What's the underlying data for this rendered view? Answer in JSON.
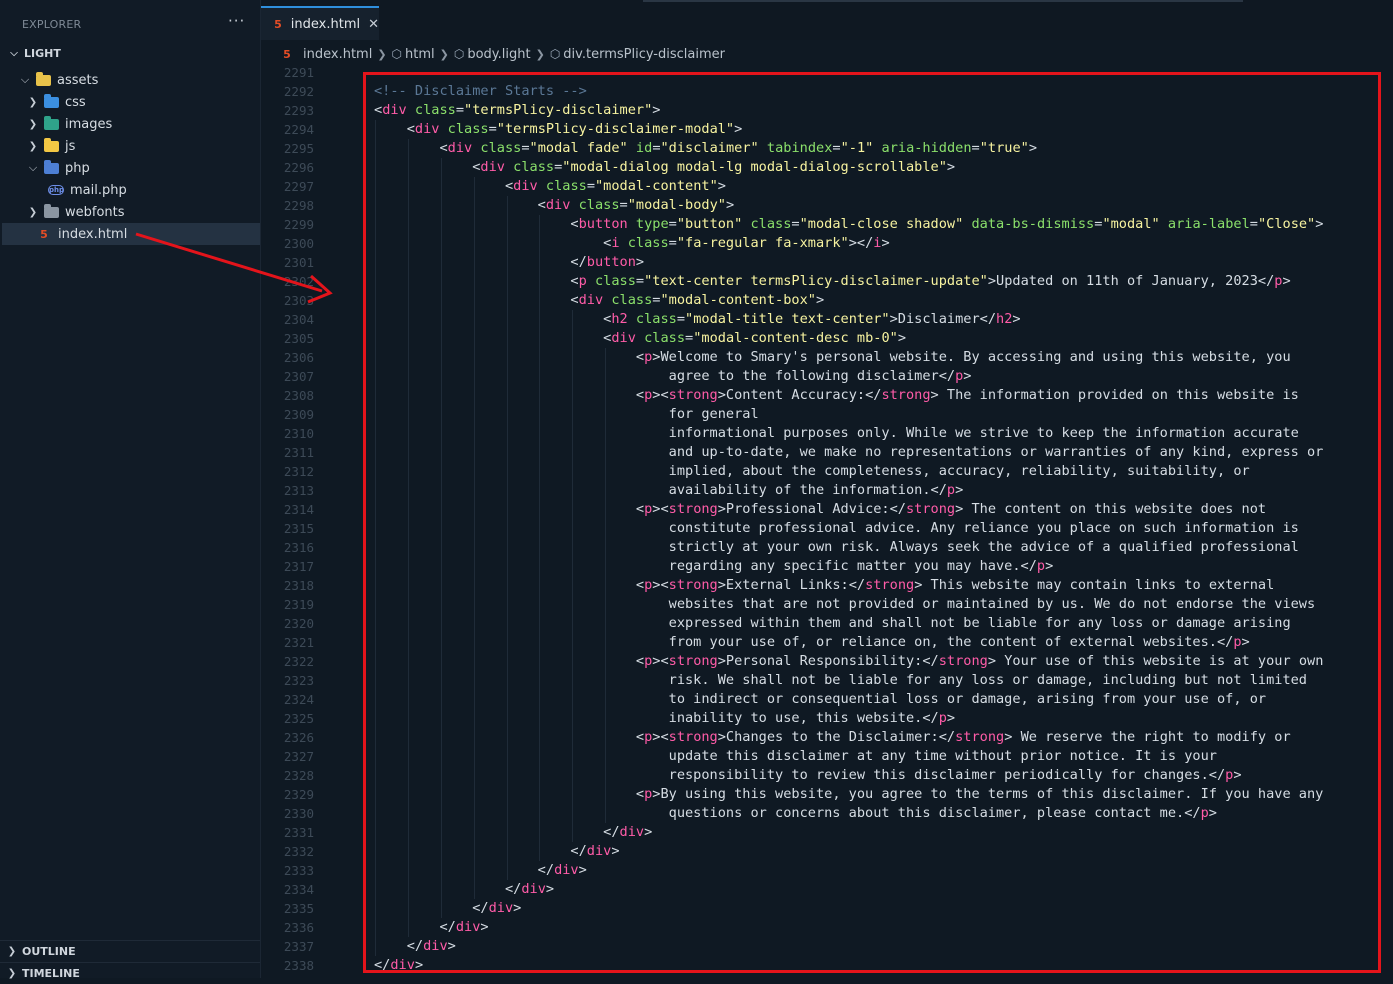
{
  "sidebar": {
    "title": "EXPLORER",
    "more": "···",
    "root": "LIGHT",
    "items": [
      {
        "label": "assets",
        "kind": "folder",
        "color": "#e8c24a",
        "open": true,
        "depth": 1
      },
      {
        "label": "css",
        "kind": "folder",
        "color": "#3b8fe0",
        "open": false,
        "depth": 2
      },
      {
        "label": "images",
        "kind": "folder",
        "color": "#2fa38a",
        "open": false,
        "depth": 2
      },
      {
        "label": "js",
        "kind": "folder",
        "color": "#f2c744",
        "open": false,
        "depth": 2
      },
      {
        "label": "php",
        "kind": "folder",
        "color": "#4d7fd4",
        "open": true,
        "depth": 2
      },
      {
        "label": "mail.php",
        "kind": "php",
        "color": "#6d8ee8",
        "depth": 3
      },
      {
        "label": "webfonts",
        "kind": "folder",
        "color": "#8b96a2",
        "open": false,
        "depth": 2
      },
      {
        "label": "index.html",
        "kind": "html",
        "color": "#e44d26",
        "depth": 1,
        "selected": true
      }
    ],
    "outline": "OUTLINE",
    "timeline": "TIMELINE"
  },
  "tab": {
    "label": "index.html",
    "close": "✕",
    "icon": "html5-icon"
  },
  "breadcrumb": [
    "index.html",
    "html",
    "body.light",
    "div.termsPlicy-disclaimer"
  ],
  "editor": {
    "first_line": 2291,
    "line_numbers": [
      2291,
      2292,
      2293,
      2294,
      2295,
      2296,
      2297,
      2298,
      2299,
      2300,
      2301,
      2302,
      2303,
      2304,
      2305,
      2306,
      2307,
      2308,
      2309,
      2310,
      2311,
      2312,
      2313,
      2314,
      2315,
      2316,
      2317,
      2318,
      2319,
      2320,
      2321,
      2322,
      2323,
      2324,
      2325,
      2326,
      2327,
      2328,
      2329,
      2330,
      2331,
      2332,
      2333,
      2334,
      2335,
      2336,
      2337,
      2338
    ],
    "lines": [
      [],
      [
        [
          "cm",
          "<!-- Disclaimer Starts -->"
        ]
      ],
      [
        [
          "pl",
          "<"
        ],
        [
          "tg",
          "div"
        ],
        [
          "at",
          " class"
        ],
        [
          "pl",
          "="
        ],
        [
          "st",
          "\"termsPlicy-disclaimer\""
        ],
        [
          "pl",
          ">"
        ]
      ],
      [
        [
          "pl",
          "    <"
        ],
        [
          "tg",
          "div"
        ],
        [
          "at",
          " class"
        ],
        [
          "pl",
          "="
        ],
        [
          "st",
          "\"termsPlicy-disclaimer-modal\""
        ],
        [
          "pl",
          ">"
        ]
      ],
      [
        [
          "pl",
          "        <"
        ],
        [
          "tg",
          "div"
        ],
        [
          "at",
          " class"
        ],
        [
          "pl",
          "="
        ],
        [
          "st",
          "\"modal fade\""
        ],
        [
          "at",
          " id"
        ],
        [
          "pl",
          "="
        ],
        [
          "st",
          "\"disclaimer\""
        ],
        [
          "at",
          " tabindex"
        ],
        [
          "pl",
          "="
        ],
        [
          "st",
          "\"-1\""
        ],
        [
          "at",
          " aria-hidden"
        ],
        [
          "pl",
          "="
        ],
        [
          "st",
          "\"true\""
        ],
        [
          "pl",
          ">"
        ]
      ],
      [
        [
          "pl",
          "            <"
        ],
        [
          "tg",
          "div"
        ],
        [
          "at",
          " class"
        ],
        [
          "pl",
          "="
        ],
        [
          "st",
          "\"modal-dialog modal-lg modal-dialog-scrollable\""
        ],
        [
          "pl",
          ">"
        ]
      ],
      [
        [
          "pl",
          "                <"
        ],
        [
          "tg",
          "div"
        ],
        [
          "at",
          " class"
        ],
        [
          "pl",
          "="
        ],
        [
          "st",
          "\"modal-content\""
        ],
        [
          "pl",
          ">"
        ]
      ],
      [
        [
          "pl",
          "                    <"
        ],
        [
          "tg",
          "div"
        ],
        [
          "at",
          " class"
        ],
        [
          "pl",
          "="
        ],
        [
          "st",
          "\"modal-body\""
        ],
        [
          "pl",
          ">"
        ]
      ],
      [
        [
          "pl",
          "                        <"
        ],
        [
          "tg",
          "button"
        ],
        [
          "at",
          " type"
        ],
        [
          "pl",
          "="
        ],
        [
          "st",
          "\"button\""
        ],
        [
          "at",
          " class"
        ],
        [
          "pl",
          "="
        ],
        [
          "st",
          "\"modal-close shadow\""
        ],
        [
          "at",
          " data-bs-dismiss"
        ],
        [
          "pl",
          "="
        ],
        [
          "st",
          "\"modal\""
        ],
        [
          "at",
          " aria-label"
        ],
        [
          "pl",
          "="
        ],
        [
          "st",
          "\"Close\""
        ],
        [
          "pl",
          ">"
        ]
      ],
      [
        [
          "pl",
          "                            <"
        ],
        [
          "tg",
          "i"
        ],
        [
          "at",
          " class"
        ],
        [
          "pl",
          "="
        ],
        [
          "st",
          "\"fa-regular fa-xmark\""
        ],
        [
          "pl",
          "></"
        ],
        [
          "tg",
          "i"
        ],
        [
          "pl",
          ">"
        ]
      ],
      [
        [
          "pl",
          "                        </"
        ],
        [
          "tg",
          "button"
        ],
        [
          "pl",
          ">"
        ]
      ],
      [
        [
          "pl",
          "                        <"
        ],
        [
          "tg",
          "p"
        ],
        [
          "at",
          " class"
        ],
        [
          "pl",
          "="
        ],
        [
          "st",
          "\"text-center termsPlicy-disclaimer-update\""
        ],
        [
          "pl",
          ">Updated on 11th of January, 2023</"
        ],
        [
          "tg",
          "p"
        ],
        [
          "pl",
          ">"
        ]
      ],
      [
        [
          "pl",
          "                        <"
        ],
        [
          "tg",
          "div"
        ],
        [
          "at",
          " class"
        ],
        [
          "pl",
          "="
        ],
        [
          "st",
          "\"modal-content-box\""
        ],
        [
          "pl",
          ">"
        ]
      ],
      [
        [
          "pl",
          "                            <"
        ],
        [
          "tg",
          "h2"
        ],
        [
          "at",
          " class"
        ],
        [
          "pl",
          "="
        ],
        [
          "st",
          "\"modal-title text-center\""
        ],
        [
          "pl",
          ">Disclaimer</"
        ],
        [
          "tg",
          "h2"
        ],
        [
          "pl",
          ">"
        ]
      ],
      [
        [
          "pl",
          "                            <"
        ],
        [
          "tg",
          "div"
        ],
        [
          "at",
          " class"
        ],
        [
          "pl",
          "="
        ],
        [
          "st",
          "\"modal-content-desc mb-0\""
        ],
        [
          "pl",
          ">"
        ]
      ],
      [
        [
          "pl",
          "                                <"
        ],
        [
          "tg",
          "p"
        ],
        [
          "pl",
          ">Welcome to Smary's personal website. By accessing and using this website, you"
        ]
      ],
      [
        [
          "pl",
          "                                    agree to the following disclaimer</"
        ],
        [
          "tg",
          "p"
        ],
        [
          "pl",
          ">"
        ]
      ],
      [
        [
          "pl",
          "                                <"
        ],
        [
          "tg",
          "p"
        ],
        [
          "pl",
          "><"
        ],
        [
          "tg",
          "strong"
        ],
        [
          "pl",
          ">Content Accuracy:</"
        ],
        [
          "tg",
          "strong"
        ],
        [
          "pl",
          "> The information provided on this website is"
        ]
      ],
      [
        [
          "pl",
          "                                    for general"
        ]
      ],
      [
        [
          "pl",
          "                                    informational purposes only. While we strive to keep the information accurate"
        ]
      ],
      [
        [
          "pl",
          "                                    and up-to-date, we make no representations or warranties of any kind, express or"
        ]
      ],
      [
        [
          "pl",
          "                                    implied, about the completeness, accuracy, reliability, suitability, or"
        ]
      ],
      [
        [
          "pl",
          "                                    availability of the information.</"
        ],
        [
          "tg",
          "p"
        ],
        [
          "pl",
          ">"
        ]
      ],
      [
        [
          "pl",
          "                                <"
        ],
        [
          "tg",
          "p"
        ],
        [
          "pl",
          "><"
        ],
        [
          "tg",
          "strong"
        ],
        [
          "pl",
          ">Professional Advice:</"
        ],
        [
          "tg",
          "strong"
        ],
        [
          "pl",
          "> The content on this website does not"
        ]
      ],
      [
        [
          "pl",
          "                                    constitute professional advice. Any reliance you place on such information is"
        ]
      ],
      [
        [
          "pl",
          "                                    strictly at your own risk. Always seek the advice of a qualified professional"
        ]
      ],
      [
        [
          "pl",
          "                                    regarding any specific matter you may have.</"
        ],
        [
          "tg",
          "p"
        ],
        [
          "pl",
          ">"
        ]
      ],
      [
        [
          "pl",
          "                                <"
        ],
        [
          "tg",
          "p"
        ],
        [
          "pl",
          "><"
        ],
        [
          "tg",
          "strong"
        ],
        [
          "pl",
          ">External Links:</"
        ],
        [
          "tg",
          "strong"
        ],
        [
          "pl",
          "> This website may contain links to external"
        ]
      ],
      [
        [
          "pl",
          "                                    websites that are not provided or maintained by us. We do not endorse the views"
        ]
      ],
      [
        [
          "pl",
          "                                    expressed within them and shall not be liable for any loss or damage arising"
        ]
      ],
      [
        [
          "pl",
          "                                    from your use of, or reliance on, the content of external websites.</"
        ],
        [
          "tg",
          "p"
        ],
        [
          "pl",
          ">"
        ]
      ],
      [
        [
          "pl",
          "                                <"
        ],
        [
          "tg",
          "p"
        ],
        [
          "pl",
          "><"
        ],
        [
          "tg",
          "strong"
        ],
        [
          "pl",
          ">Personal Responsibility:</"
        ],
        [
          "tg",
          "strong"
        ],
        [
          "pl",
          "> Your use of this website is at your own"
        ]
      ],
      [
        [
          "pl",
          "                                    risk. We shall not be liable for any loss or damage, including but not limited"
        ]
      ],
      [
        [
          "pl",
          "                                    to indirect or consequential loss or damage, arising from your use of, or"
        ]
      ],
      [
        [
          "pl",
          "                                    inability to use, this website.</"
        ],
        [
          "tg",
          "p"
        ],
        [
          "pl",
          ">"
        ]
      ],
      [
        [
          "pl",
          "                                <"
        ],
        [
          "tg",
          "p"
        ],
        [
          "pl",
          "><"
        ],
        [
          "tg",
          "strong"
        ],
        [
          "pl",
          ">Changes to the Disclaimer:</"
        ],
        [
          "tg",
          "strong"
        ],
        [
          "pl",
          "> We reserve the right to modify or"
        ]
      ],
      [
        [
          "pl",
          "                                    update this disclaimer at any time without prior notice. It is your"
        ]
      ],
      [
        [
          "pl",
          "                                    responsibility to review this disclaimer periodically for changes.</"
        ],
        [
          "tg",
          "p"
        ],
        [
          "pl",
          ">"
        ]
      ],
      [
        [
          "pl",
          "                                <"
        ],
        [
          "tg",
          "p"
        ],
        [
          "pl",
          ">By using this website, you agree to the terms of this disclaimer. If you have any"
        ]
      ],
      [
        [
          "pl",
          "                                    questions or concerns about this disclaimer, please contact me.</"
        ],
        [
          "tg",
          "p"
        ],
        [
          "pl",
          ">"
        ]
      ],
      [
        [
          "pl",
          "                            </"
        ],
        [
          "tg",
          "div"
        ],
        [
          "pl",
          ">"
        ]
      ],
      [
        [
          "pl",
          "                        </"
        ],
        [
          "tg",
          "div"
        ],
        [
          "pl",
          ">"
        ]
      ],
      [
        [
          "pl",
          "                    </"
        ],
        [
          "tg",
          "div"
        ],
        [
          "pl",
          ">"
        ]
      ],
      [
        [
          "pl",
          "                </"
        ],
        [
          "tg",
          "div"
        ],
        [
          "pl",
          ">"
        ]
      ],
      [
        [
          "pl",
          "            </"
        ],
        [
          "tg",
          "div"
        ],
        [
          "pl",
          ">"
        ]
      ],
      [
        [
          "pl",
          "        </"
        ],
        [
          "tg",
          "div"
        ],
        [
          "pl",
          ">"
        ]
      ],
      [
        [
          "pl",
          "    </"
        ],
        [
          "tg",
          "div"
        ],
        [
          "pl",
          ">"
        ]
      ],
      [
        [
          "pl",
          "</"
        ],
        [
          "tg",
          "div"
        ],
        [
          "pl",
          ">"
        ]
      ]
    ]
  },
  "annotation": {
    "box_color": "#e4141b",
    "arrow_color": "#e4141b"
  }
}
